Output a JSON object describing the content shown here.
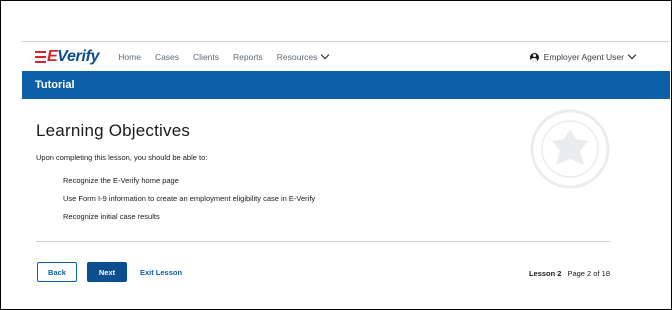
{
  "header": {
    "logo_e": "E",
    "logo_verify": "Verify",
    "nav": [
      "Home",
      "Cases",
      "Clients",
      "Reports",
      "Resources"
    ],
    "user_label": "Employer Agent User"
  },
  "banner": {
    "title": "Tutorial"
  },
  "content": {
    "title": "Learning Objectives",
    "intro": "Upon completing this lesson, you should be able to:",
    "objectives": [
      "Recognize the E-Verify home page",
      "Use Form I-9 information to create an employment eligibility case in E-Verify",
      "Recognize initial case results"
    ]
  },
  "footer": {
    "back_label": "Back",
    "next_label": "Next",
    "exit_label": "Exit Lesson",
    "lesson": "Lesson 2",
    "page": "Page 2 of 18"
  },
  "colors": {
    "brand_blue": "#0d5fa8",
    "logo_red": "#d6262b"
  },
  "icons": [
    "flag-icon",
    "chevron-down-icon",
    "user-icon",
    "dhs-seal-icon"
  ]
}
